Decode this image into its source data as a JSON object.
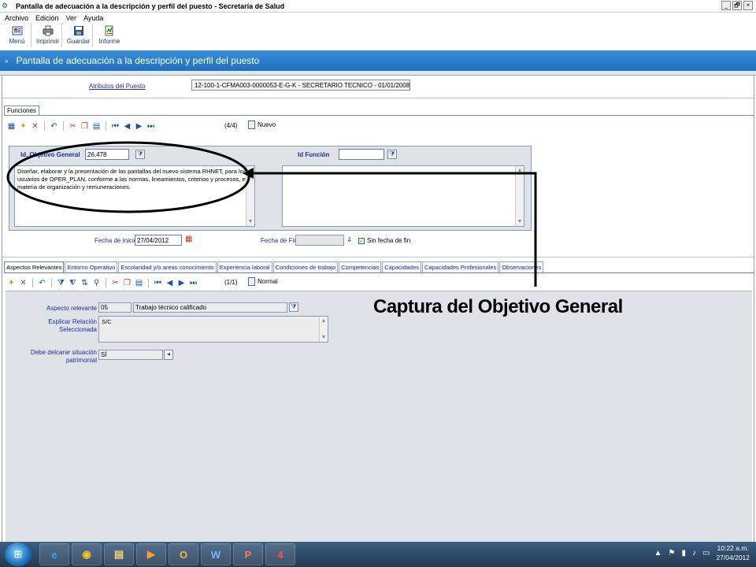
{
  "window": {
    "title": "Pantalla de adecuación a la descripción y perfil del puesto  - Secretaría de Salud",
    "controls": [
      "_",
      "🗗",
      "×"
    ]
  },
  "menu": [
    "Archivo",
    "Edición",
    "Ver",
    "Ayuda"
  ],
  "toolbar": [
    {
      "label": "Menú",
      "icon": "menu-icon"
    },
    {
      "label": "Imprimir",
      "icon": "printer-icon"
    },
    {
      "label": "Guardar",
      "icon": "save-icon"
    },
    {
      "label": "Informe",
      "icon": "report-icon"
    }
  ],
  "header": {
    "title": "Pantalla de adecuación a la descripción y perfil del puesto"
  },
  "attributes": {
    "label": "Atributos del Puesto",
    "value": "12-100-1-CFMA003-0000053-E-G-K - SECRETARIO TECNICO - 01/01/2008"
  },
  "funciones": {
    "tab_label": "Funciones",
    "counter": "(4/4)",
    "mode": "Nuevo",
    "objetivo_label": "Id. Objetivo General",
    "objetivo_value": "26,478",
    "funcion_label": "Id Función",
    "funcion_value": "",
    "description": "Diseñar, elaborar y la presentación de las pantallas del nuevo sistema RHNET, para los usuarios de OPER_PLAN, conforme a las normas, lineamientos, criterios y procesos, en materia de organización y remuneraciones.",
    "fecha_inicio_label": "Fecha de Inicio",
    "fecha_inicio_value": "27/04/2012",
    "fecha_fin_label": "Fecha de Fin",
    "sin_fecha_label": "Sin fecha de fin",
    "sin_fecha_checked": true
  },
  "tabs": [
    "Aspectos Relevantes",
    "Entorno Operativo",
    "Escolaridad y/o areas conocimiento",
    "Experiencia laboral",
    "Condiciones de trabajo",
    "Competencias",
    "Capacidades",
    "Capacidades Profesionales",
    "Observaciones"
  ],
  "aspectos": {
    "counter": "(1/1)",
    "mode": "Normal",
    "aspecto_label": "Aspecto relevante",
    "aspecto_code": "05",
    "aspecto_desc": "Trabajo técnico calificado",
    "explicar_label": "Explicar Relación Seleccionada",
    "explicar_value": "S/C",
    "patrimonial_label": "Debe delcarar situación patrimonial",
    "patrimonial_value": "SÍ"
  },
  "annotation": {
    "text": "Captura del Objetivo General"
  },
  "taskbar": {
    "apps": [
      "e",
      "◉",
      "▤",
      "▶",
      "O",
      "W",
      "P",
      "4"
    ],
    "time": "10:22 a.m.",
    "date": "27/04/2012"
  },
  "colors": {
    "header_blue": "#1f6fbf",
    "link_blue": "#1f2f9a",
    "panel_gray": "#dfe3e8",
    "taskbar": "#22384f"
  }
}
